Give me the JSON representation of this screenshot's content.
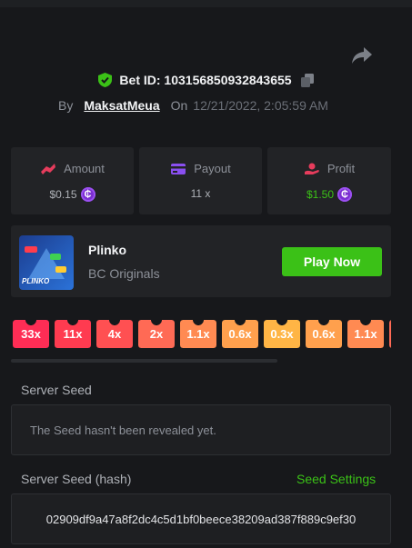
{
  "bet": {
    "id_label": "Bet ID: 10315685093284365​5",
    "by_label": "By",
    "user": "MaksatMeua",
    "on_label": "On",
    "date": "12/21/2022, 2:05:59 AM"
  },
  "stats": [
    {
      "label": "Amount",
      "value": "$0.15",
      "icon": "amount-icon",
      "color": "#e63c5c",
      "coin": true,
      "value_color": "#aeb1b7"
    },
    {
      "label": "Payout",
      "value": "11 x",
      "icon": "payout-icon",
      "color": "#8a4ff0",
      "coin": false,
      "value_color": "#aeb1b7"
    },
    {
      "label": "Profit",
      "value": "$1.50",
      "icon": "profit-icon",
      "color": "#e63c5c",
      "coin": true,
      "value_color": "#3bc117"
    }
  ],
  "coin_symbol": "₵",
  "game": {
    "name": "Plinko",
    "provider": "BC Originals",
    "thumb_label": "PLINKO",
    "play_label": "Play Now"
  },
  "multipliers": [
    {
      "label": "33x",
      "color": "#ff2d55"
    },
    {
      "label": "11x",
      "color": "#ff3b50"
    },
    {
      "label": "4x",
      "color": "#ff5052"
    },
    {
      "label": "2x",
      "color": "#ff6a55"
    },
    {
      "label": "1.1x",
      "color": "#ff8a52"
    },
    {
      "label": "0.6x",
      "color": "#ffa04d"
    },
    {
      "label": "0.3x",
      "color": "#ffb545"
    },
    {
      "label": "0.6x",
      "color": "#ffa04d"
    },
    {
      "label": "1.1x",
      "color": "#ff8a52"
    },
    {
      "label": "",
      "color": "#ff6a55"
    }
  ],
  "server_seed": {
    "label": "Server Seed",
    "value": "The Seed hasn't been revealed yet."
  },
  "server_seed_hash": {
    "label": "Server Seed (hash)",
    "settings_label": "Seed Settings",
    "value": "02909df9a47a8f2dc4c5d1bf0beece38209ad387f889c9ef30"
  },
  "colors": {
    "accent_green": "#3bc117",
    "background": "#17181b",
    "panel": "#222326"
  }
}
